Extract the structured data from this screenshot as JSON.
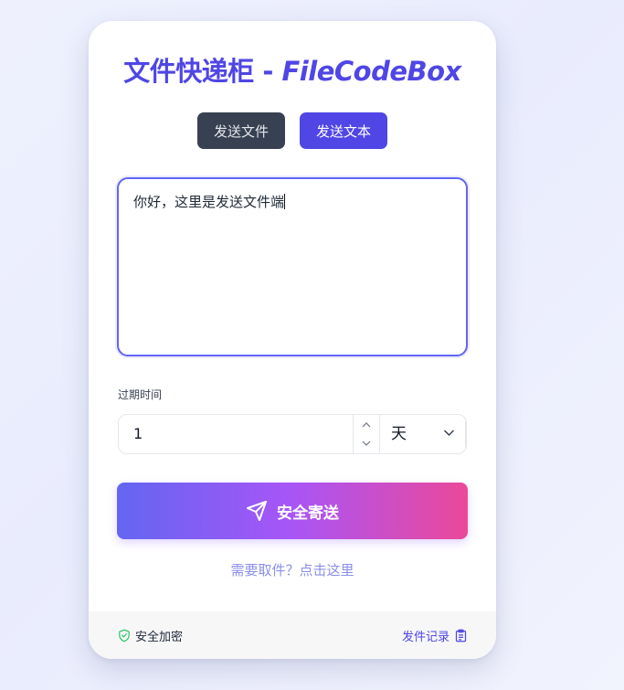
{
  "header": {
    "title_cn": "文件快递柜 - ",
    "title_en": "FileCodeBox"
  },
  "tabs": [
    {
      "label": "发送文件",
      "active": false
    },
    {
      "label": "发送文本",
      "active": true
    }
  ],
  "text_input": {
    "value": "你好，这里是发送文件端"
  },
  "expiry": {
    "label": "过期时间",
    "value": "1",
    "unit": "天"
  },
  "send_button": {
    "label": "安全寄送",
    "icon": "send-icon"
  },
  "retrieve_link": "需要取件？点击这里",
  "footer": {
    "secure_label": "安全加密",
    "secure_icon": "shield-check-icon",
    "records_label": "发件记录",
    "records_icon": "clipboard-icon"
  },
  "colors": {
    "accent": "#4f46e5",
    "tab_inactive": "#374151",
    "gradient_start": "#6366f1",
    "gradient_mid": "#a855f7",
    "gradient_end": "#ec4899",
    "secure_green": "#22c55e"
  }
}
